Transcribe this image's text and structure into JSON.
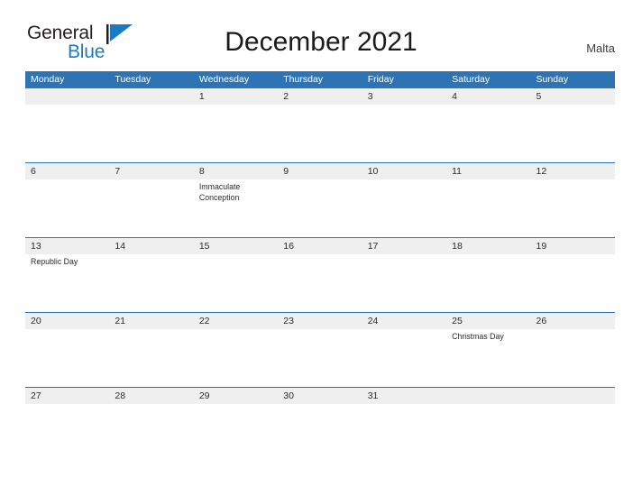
{
  "brand": {
    "name_part1": "General",
    "name_part2": "Blue",
    "flag_icon": "triangle-flag-icon",
    "color_primary": "#1a7bc4",
    "color_text": "#231f20"
  },
  "header": {
    "title": "December 2021",
    "country": "Malta"
  },
  "calendar": {
    "accent_color": "#2e74b5",
    "band_color": "#efefef",
    "weekday_headers": [
      "Monday",
      "Tuesday",
      "Wednesday",
      "Thursday",
      "Friday",
      "Saturday",
      "Sunday"
    ],
    "weeks": [
      [
        {
          "day": "",
          "event": ""
        },
        {
          "day": "",
          "event": ""
        },
        {
          "day": "1",
          "event": ""
        },
        {
          "day": "2",
          "event": ""
        },
        {
          "day": "3",
          "event": ""
        },
        {
          "day": "4",
          "event": ""
        },
        {
          "day": "5",
          "event": ""
        }
      ],
      [
        {
          "day": "6",
          "event": ""
        },
        {
          "day": "7",
          "event": ""
        },
        {
          "day": "8",
          "event": "Immaculate Conception"
        },
        {
          "day": "9",
          "event": ""
        },
        {
          "day": "10",
          "event": ""
        },
        {
          "day": "11",
          "event": ""
        },
        {
          "day": "12",
          "event": ""
        }
      ],
      [
        {
          "day": "13",
          "event": "Republic Day"
        },
        {
          "day": "14",
          "event": ""
        },
        {
          "day": "15",
          "event": ""
        },
        {
          "day": "16",
          "event": ""
        },
        {
          "day": "17",
          "event": ""
        },
        {
          "day": "18",
          "event": ""
        },
        {
          "day": "19",
          "event": ""
        }
      ],
      [
        {
          "day": "20",
          "event": ""
        },
        {
          "day": "21",
          "event": ""
        },
        {
          "day": "22",
          "event": ""
        },
        {
          "day": "23",
          "event": ""
        },
        {
          "day": "24",
          "event": ""
        },
        {
          "day": "25",
          "event": "Christmas Day"
        },
        {
          "day": "26",
          "event": ""
        }
      ],
      [
        {
          "day": "27",
          "event": ""
        },
        {
          "day": "28",
          "event": ""
        },
        {
          "day": "29",
          "event": ""
        },
        {
          "day": "30",
          "event": ""
        },
        {
          "day": "31",
          "event": ""
        },
        {
          "day": "",
          "event": ""
        },
        {
          "day": "",
          "event": ""
        }
      ]
    ]
  }
}
